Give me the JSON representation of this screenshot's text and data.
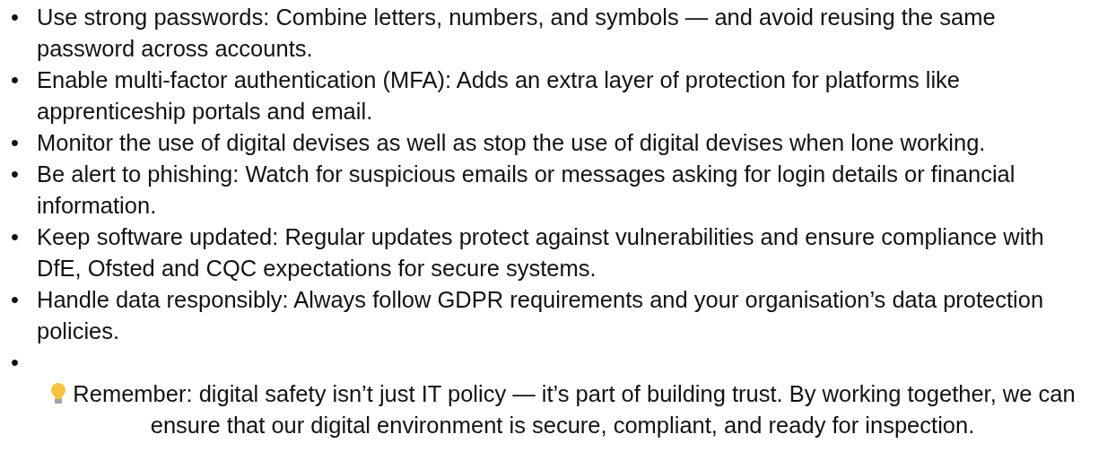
{
  "bullets": [
    {
      "marker": "•",
      "text": "Use strong passwords: Combine letters, numbers, and symbols — and avoid reusing the same password across accounts."
    },
    {
      "marker": "•",
      "text": "Enable multi-factor authentication (MFA): Adds an extra layer of protection for platforms like apprenticeship portals and email."
    },
    {
      "marker": "•",
      "text": "Monitor the use of digital devises as well as stop the use of digital devises when lone working."
    },
    {
      "marker": "•",
      "text": "Be alert to phishing: Watch for suspicious emails or messages asking for login details or financial information."
    },
    {
      "marker": "•",
      "text": "Keep software updated: Regular updates protect against vulnerabilities and ensure compliance with DfE, Ofsted and CQC expectations for secure systems."
    },
    {
      "marker": "•",
      "text": "Handle data responsibly: Always follow GDPR requirements and your organisation’s data protection policies."
    },
    {
      "marker": "•"
    }
  ],
  "reminder": {
    "text": "Remember: digital safety isn’t just IT policy — it’s part of building trust. By working together, we can ensure that our digital environment is secure, compliant, and ready for inspection."
  }
}
